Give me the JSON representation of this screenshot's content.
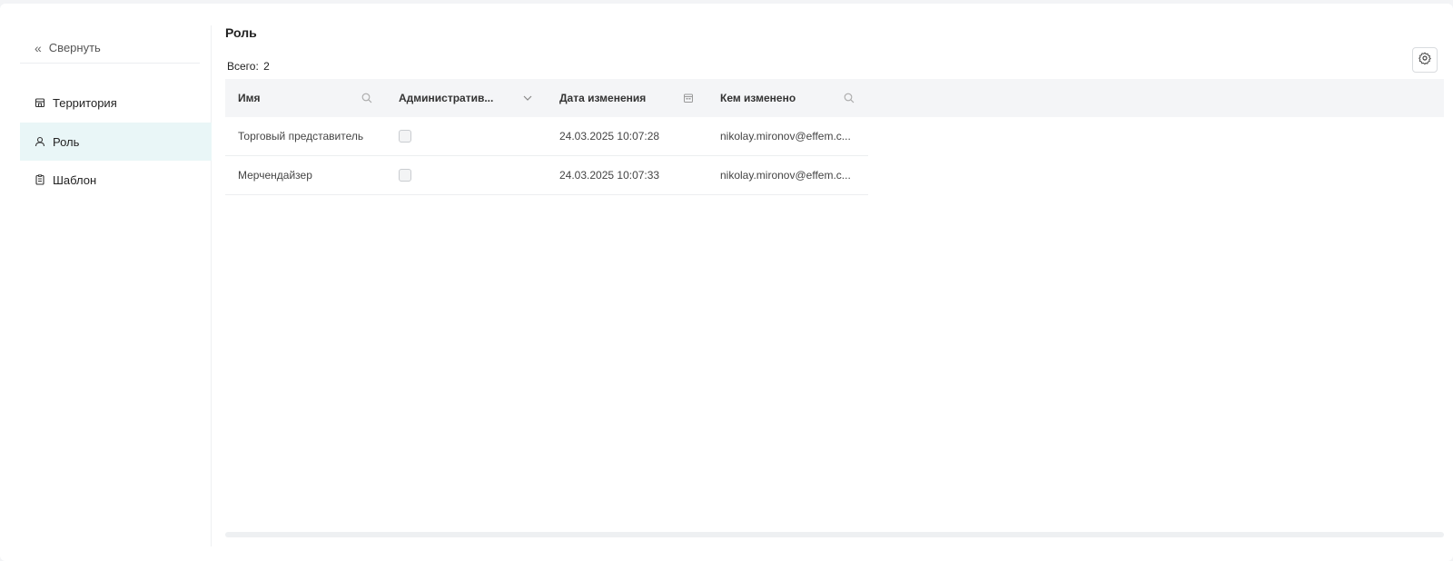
{
  "sidebar": {
    "collapse_label": "Свернуть",
    "items": [
      {
        "label": "Территория",
        "icon": "store-icon",
        "active": false
      },
      {
        "label": "Роль",
        "icon": "user-icon",
        "active": true
      },
      {
        "label": "Шаблон",
        "icon": "clipboard-icon",
        "active": false
      }
    ]
  },
  "main": {
    "title": "Роль",
    "total_label": "Всего:",
    "total_count": "2"
  },
  "table": {
    "columns": [
      {
        "label": "Имя",
        "icon": "search-icon"
      },
      {
        "label": "Административ...",
        "icon": "chevron-down-icon"
      },
      {
        "label": "Дата изменения",
        "icon": "calendar-icon"
      },
      {
        "label": "Кем изменено",
        "icon": "search-icon"
      }
    ],
    "rows": [
      {
        "name": "Торговый представитель",
        "admin": false,
        "date": "24.03.2025 10:07:28",
        "changed_by": "nikolay.mironov@effem.c..."
      },
      {
        "name": "Мерчендайзер",
        "admin": false,
        "date": "24.03.2025 10:07:33",
        "changed_by": "nikolay.mironov@effem.c..."
      }
    ]
  },
  "colors": {
    "active_bg": "#e9f6f7",
    "header_bg": "#f4f5f7"
  }
}
